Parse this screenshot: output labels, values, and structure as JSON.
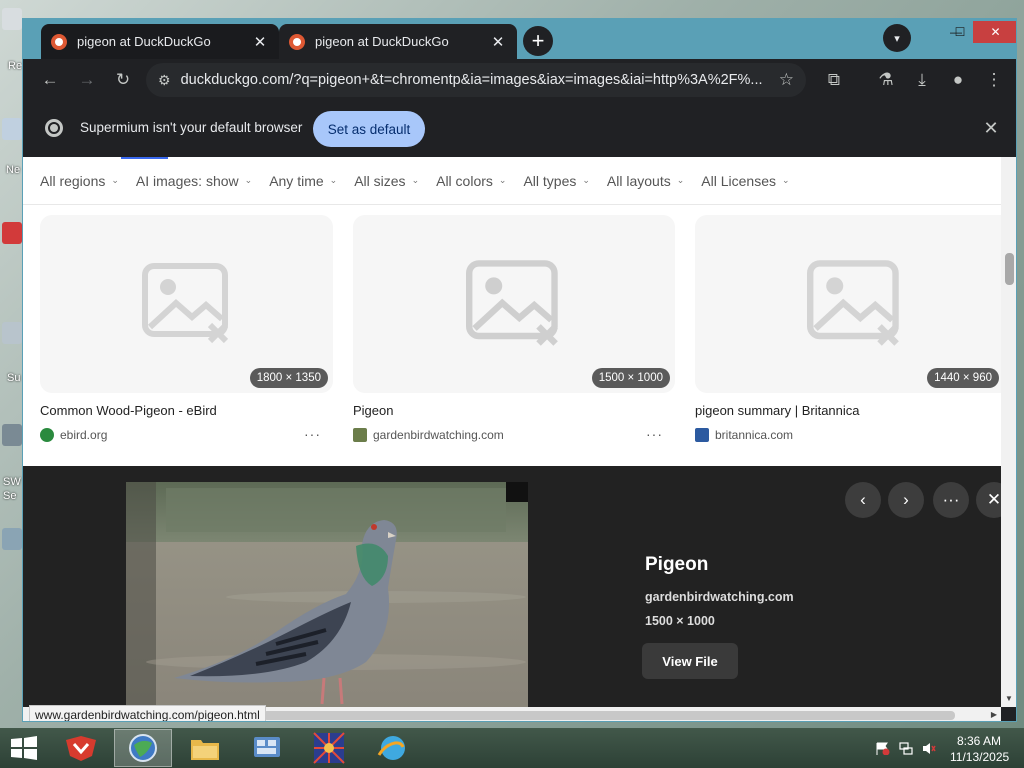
{
  "desktop": {
    "icon_labels": [
      "Re",
      "Ne",
      "Su",
      "SW",
      "Se"
    ]
  },
  "window": {
    "tabs": [
      {
        "title": "pigeon at DuckDuckGo",
        "close": "✕"
      },
      {
        "title": "pigeon at DuckDuckGo",
        "close": "✕"
      }
    ],
    "new_tab": "+",
    "tab_search": "▾",
    "controls": {
      "minimize": "—",
      "maximize": "☐",
      "close": "✕"
    }
  },
  "toolbar": {
    "back": "←",
    "forward": "→",
    "reload": "↻",
    "site_info": "⚙",
    "url": "duckduckgo.com/?q=pigeon+&t=chromentp&ia=images&iax=images&iai=http%3A%2F%...",
    "bookmark_star": "☆",
    "extensions": "⧉",
    "labs": "⚗",
    "download": "⤓",
    "profile": "●",
    "menu": "⋮"
  },
  "infobar": {
    "message": "Supermium isn't your default browser",
    "button": "Set as default",
    "close": "✕"
  },
  "filters": [
    "All regions",
    "AI images: show",
    "Any time",
    "All sizes",
    "All colors",
    "All types",
    "All layouts",
    "All Licenses"
  ],
  "filter_chevron": "⌄",
  "results": [
    {
      "title": "Common Wood-Pigeon - eBird",
      "source": "ebird.org",
      "dims": "1800 × 1350",
      "favicon_color": "#2a8a3e",
      "more": "···"
    },
    {
      "title": "Pigeon",
      "source": "gardenbirdwatching.com",
      "dims": "1500 × 1000",
      "favicon_color": "#6b7d4a",
      "more": "···"
    },
    {
      "title": "pigeon summary | Britannica",
      "source": "britannica.com",
      "dims": "1440 × 960",
      "favicon_color": "#2c5aa0",
      "more": "···"
    }
  ],
  "detail": {
    "title": "Pigeon",
    "domain": "gardenbirdwatching.com",
    "dims": "1500 × 1000",
    "view_button": "View File",
    "prev": "‹",
    "next": "›",
    "more": "···",
    "close": "✕"
  },
  "status_url": "www.gardenbirdwatching.com/pigeon.html",
  "taskbar": {
    "time": "8:36 AM",
    "date": "11/13/2025"
  }
}
